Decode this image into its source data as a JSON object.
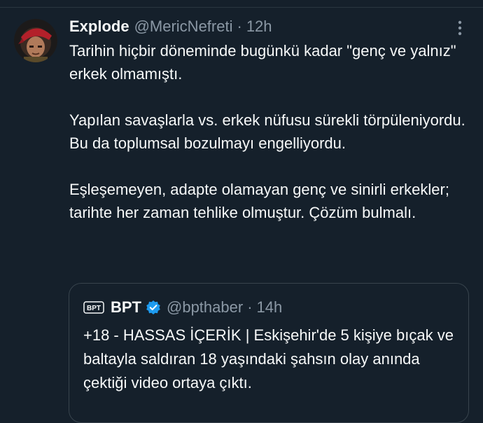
{
  "tweet": {
    "display_name": "Explode",
    "handle": "@MericNefreti",
    "separator": "·",
    "time": "12h",
    "avatar_icon": "user-avatar",
    "more_icon": "more-vertical-icon",
    "paragraphs": [
      "Tarihin hiçbir döneminde bugünkü kadar \"genç ve yalnız\" erkek olmamıştı.",
      "Yapılan savaşlarla vs. erkek nüfusu sürekli törpüleniyordu. Bu da toplumsal bozulmayı engelliyordu.",
      "Eşleşemeyen, adapte olamayan genç ve sinirli erkekler; tarihte her zaman tehlike olmuştur. Çözüm bulmalı."
    ]
  },
  "quote": {
    "logo_text": "BPT",
    "display_name": "BPT",
    "verified_icon": "verified-badge-icon",
    "handle": "@bpthaber",
    "separator": "·",
    "time": "14h",
    "text": "+18 - HASSAS İÇERİK | Eskişehir'de 5 kişiye bıçak ve baltayla saldıran 18 yaşındaki şahsın olay anında çektiği video ortaya çıktı."
  },
  "colors": {
    "background": "#15202b",
    "text_primary": "#f7f9f9",
    "text_secondary": "#8b98a5",
    "border": "#38444d",
    "verified_blue": "#1d9bf0"
  }
}
